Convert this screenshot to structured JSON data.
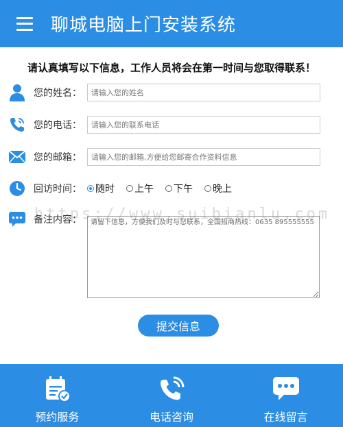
{
  "header": {
    "title": "聊城电脑上门安装系统",
    "menu_icon": "menu-icon"
  },
  "notice": "请认真填写以下信息，工作人员将会在第一时间与您取得联系！",
  "form": {
    "name": {
      "label": "您的姓名：",
      "placeholder": "请输入您的姓名",
      "icon": "user-icon"
    },
    "phone": {
      "label": "您的电话：",
      "placeholder": "请输入您的联系电话",
      "icon": "phone-icon"
    },
    "email": {
      "label": "您的邮箱：",
      "placeholder": "请输入您的邮箱,方便给您邮寄合作资料信息",
      "icon": "mail-icon"
    },
    "visit_time": {
      "label": "回访时间：",
      "icon": "clock-icon",
      "options": [
        "随时",
        "上午",
        "下午",
        "晚上"
      ],
      "selected": "随时"
    },
    "remarks": {
      "label": "备注内容：",
      "icon": "chat-icon",
      "placeholder": "请留下信息，方便我们及时与您联系，全国招商热线：0635 895555555"
    },
    "submit_label": "提交信息"
  },
  "watermark": "https://www.suibianlu.com",
  "footer": {
    "items": [
      {
        "label": "预约服务",
        "icon": "calendar-check-icon"
      },
      {
        "label": "电话咨询",
        "icon": "phone-call-icon"
      },
      {
        "label": "在线留言",
        "icon": "message-icon"
      }
    ]
  },
  "colors": {
    "primary": "#2b8de4",
    "text": "#333333"
  }
}
